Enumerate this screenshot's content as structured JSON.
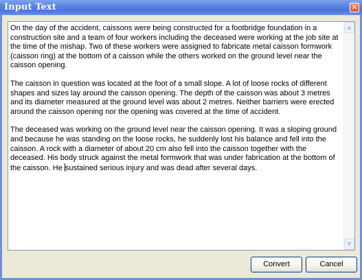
{
  "window": {
    "title": "Input Text",
    "close_glyph": "✕"
  },
  "text_area": {
    "paragraphs": [
      "On the day of the accident, caissons were being constructed for a footbridge foundation in a construction site and a team of four workers including the deceased were working at the job site at the time of the mishap. Two of these workers were assigned to fabricate metal caisson formwork (caisson ring) at the bottom of a caisson while the others worked on the ground level near the caisson opening.",
      "The caisson in question was located at the foot of a small slope. A lot of loose rocks of different shapes and sizes lay around the caisson opening. The depth of the caisson was about 3 metres and its diameter measured at the ground level was about 2 metres. Neither barriers were erected around the caisson opening nor the opening was covered at the time of accident.",
      "The deceased was working on the ground level near the caisson opening. It was a sloping ground and because he was standing on the loose rocks,  he suddenly lost his balance and fell into the caisson. A rock with a diameter of about 20 cm also fell into the caisson together with the deceased. His body struck against the metal formwork that was under fabrication at the bottom of the caisson. He "
    ],
    "last_paragraph_after_caret": "sustained serious injury and was dead after several days.",
    "scroll_up_glyph": "▲",
    "scroll_down_glyph": "▼"
  },
  "buttons": {
    "convert_label": "Convert",
    "cancel_label": "Cancel"
  },
  "colors": {
    "title_bar": "#4a74d8",
    "window_bg": "#ece9d8",
    "close_button": "#d7542f"
  }
}
